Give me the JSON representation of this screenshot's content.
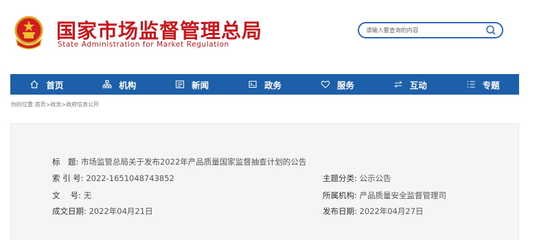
{
  "header": {
    "title_cn": "国家市场监督管理总局",
    "title_en": "State Administration for Market Regulation",
    "emblem": "national-emblem-icon"
  },
  "search": {
    "placeholder": "请输入要查询的内容",
    "icon": "search-icon"
  },
  "nav": {
    "items": [
      {
        "label": "首页",
        "icon": "home-icon"
      },
      {
        "label": "机构",
        "icon": "org-chart-icon"
      },
      {
        "label": "新闻",
        "icon": "news-icon"
      },
      {
        "label": "政务",
        "icon": "government-affairs-icon"
      },
      {
        "label": "服务",
        "icon": "heart-icon"
      },
      {
        "label": "互动",
        "icon": "interaction-arrows-icon"
      },
      {
        "label": "专题",
        "icon": "topic-list-icon"
      }
    ],
    "color": "#1d5fa9"
  },
  "breadcrumb": {
    "text": "你的位置:首页>政务>政府信息公开"
  },
  "document": {
    "title_label": "标　题:",
    "title_value": "市场监管总局关于发布2022年产品质量国家监督抽查计划的公告",
    "index_label": "索 引 号:",
    "index_value": "2022-1651048743852",
    "topic_label": "主题分类:",
    "topic_value": "公示公告",
    "doc_no_label": "文　 号:",
    "doc_no_value": "无",
    "org_label": "所属机构:",
    "org_value": "产品质量安全监督管理司",
    "created_label": "成文日期:",
    "created_value": "2022年04月21日",
    "published_label": "发布日期:",
    "published_value": "2022年04月27日"
  },
  "colors": {
    "brand_red": "#c8161d",
    "nav_blue": "#1d5fa9"
  }
}
